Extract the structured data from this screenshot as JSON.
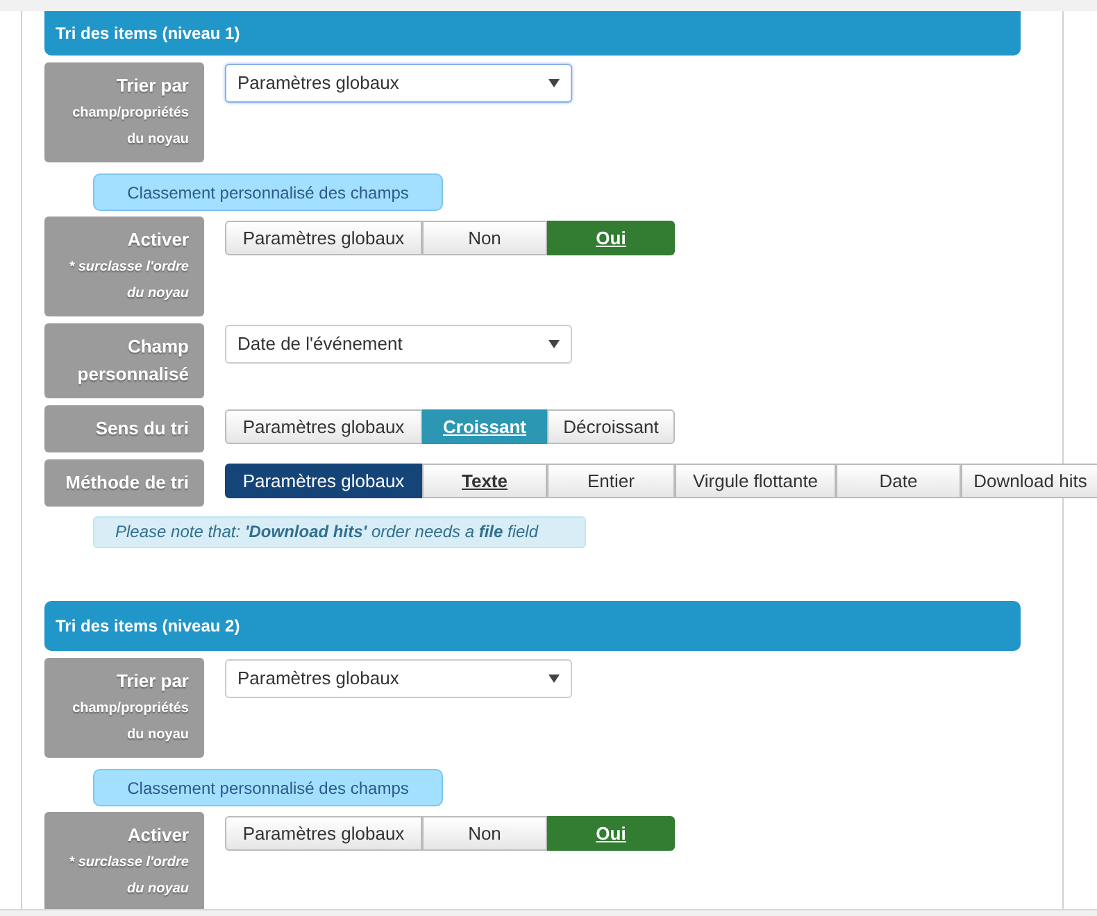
{
  "sections": [
    {
      "title": "Tri des items (niveau 1)",
      "items": [
        {
          "kind": "select",
          "label": "Trier par",
          "sublabel": [
            "champ/propriétés",
            "du noyau"
          ],
          "value": "Paramètres globaux",
          "focused": true
        },
        {
          "kind": "pill",
          "text": "Classement personnalisé des champs"
        },
        {
          "kind": "buttons",
          "label": "Activer",
          "sublabel": [
            "* surclasse l'ordre",
            "du noyau"
          ],
          "sublabel_italic": true,
          "options": [
            {
              "text": "Paramètres globaux",
              "selected": false
            },
            {
              "text": "Non",
              "selected": false
            },
            {
              "text": "Oui",
              "selected": true,
              "color": "#337d32"
            }
          ]
        },
        {
          "kind": "select",
          "label": "Champ personnalisé",
          "value": "Date de l'événement"
        },
        {
          "kind": "buttons",
          "label": "Sens du tri",
          "options": [
            {
              "text": "Paramètres globaux",
              "selected": false
            },
            {
              "text": "Croissant",
              "selected": true,
              "color": "#2b97b3"
            },
            {
              "text": "Décroissant",
              "selected": false
            }
          ]
        },
        {
          "kind": "buttons",
          "label": "Méthode de tri",
          "options": [
            {
              "text": "Paramètres globaux",
              "selected": false,
              "color": "#154578"
            },
            {
              "text": "Texte",
              "selected": true
            },
            {
              "text": "Entier",
              "selected": false
            },
            {
              "text": "Virgule flottante",
              "selected": false
            },
            {
              "text": "Date",
              "selected": false
            },
            {
              "text": "Download hits",
              "selected": false
            }
          ]
        },
        {
          "kind": "note",
          "text": "Please note that: **'Download hits'** order needs a **file** field"
        }
      ]
    },
    {
      "title": "Tri des items (niveau 2)",
      "items": [
        {
          "kind": "select",
          "label": "Trier par",
          "sublabel": [
            "champ/propriétés",
            "du noyau"
          ],
          "value": "Paramètres globaux"
        },
        {
          "kind": "pill",
          "text": "Classement personnalisé des champs"
        },
        {
          "kind": "buttons",
          "label": "Activer",
          "sublabel": [
            "* surclasse l'ordre",
            "du noyau"
          ],
          "sublabel_italic": true,
          "options": [
            {
              "text": "Paramètres globaux",
              "selected": false
            },
            {
              "text": "Non",
              "selected": false
            },
            {
              "text": "Oui",
              "selected": true,
              "color": "#337d32"
            }
          ]
        }
      ]
    }
  ]
}
